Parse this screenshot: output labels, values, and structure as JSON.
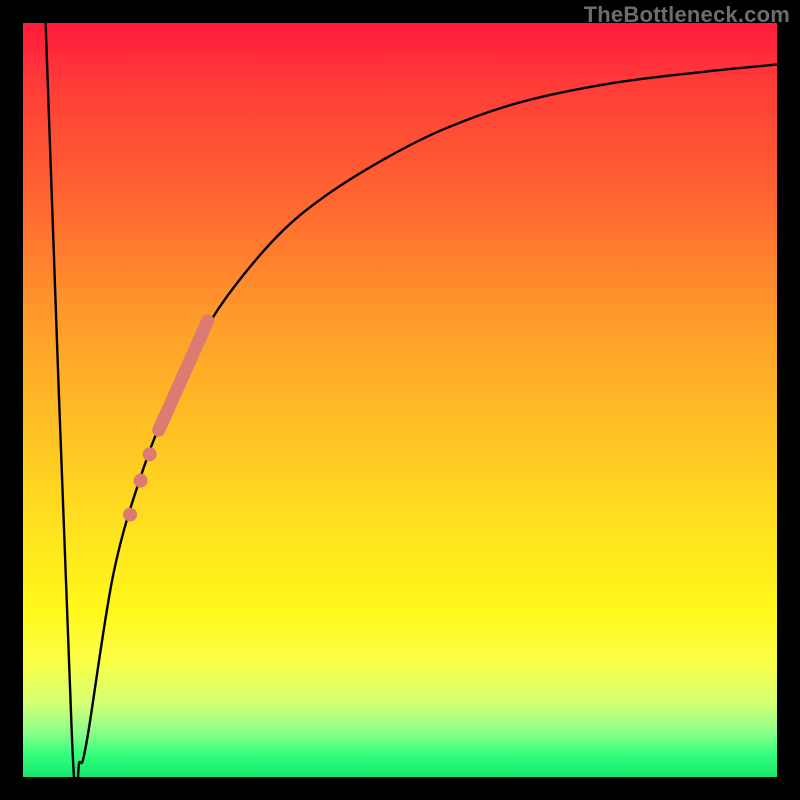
{
  "watermark": "TheBottleneck.com",
  "chart_data": {
    "type": "line",
    "title": "",
    "xlabel": "",
    "ylabel": "",
    "xlim": [
      0,
      100
    ],
    "ylim": [
      0,
      100
    ],
    "background": "rainbow-vertical",
    "series": [
      {
        "name": "bottleneck-curve",
        "x": [
          3,
          6.5,
          7.5,
          8.5,
          12,
          16,
          20,
          24,
          28,
          34,
          40,
          48,
          56,
          66,
          78,
          90,
          100
        ],
        "y": [
          100,
          5,
          2,
          5,
          27,
          41,
          51,
          59,
          65,
          72,
          77,
          82,
          86,
          89.5,
          92,
          93.5,
          94.5
        ]
      }
    ],
    "markers": [
      {
        "name": "thick-segment",
        "style": "line",
        "color": "#dc7b72",
        "width": 13,
        "x": [
          18.0,
          24.5
        ],
        "y": [
          46.0,
          60.5
        ]
      },
      {
        "name": "dots",
        "style": "circle",
        "color": "#dc7b72",
        "r": 7,
        "points": [
          {
            "x": 16.8,
            "y": 42.8
          },
          {
            "x": 15.6,
            "y": 39.3
          },
          {
            "x": 14.2,
            "y": 34.8
          }
        ]
      }
    ]
  }
}
